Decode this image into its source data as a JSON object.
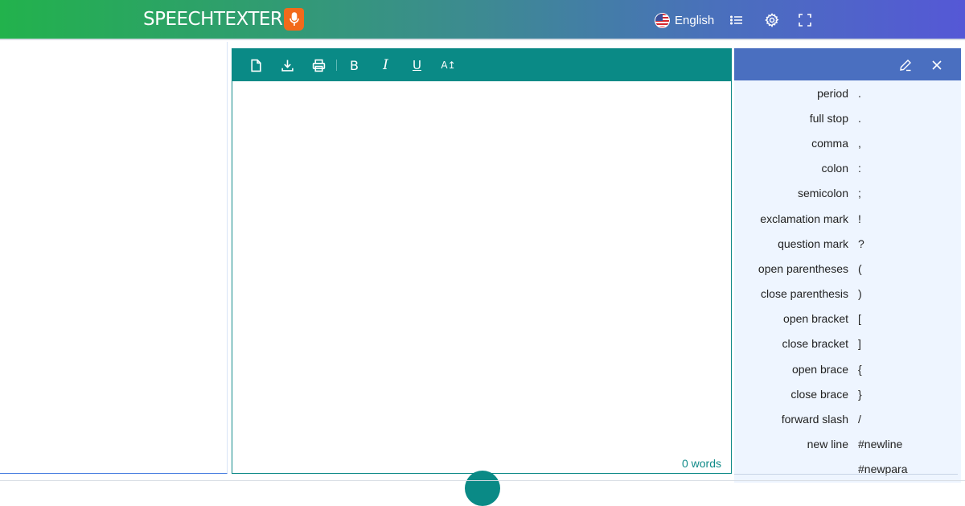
{
  "header": {
    "logo_text": "SPEECHTEXTER",
    "logo_icon": "microphone-icon",
    "language": {
      "label": "English",
      "flag_icon": "us-flag-icon"
    },
    "icons": [
      "list-icon",
      "gear-icon",
      "fullscreen-icon"
    ],
    "colors": {
      "gradient_start": "#22b24c",
      "gradient_end": "#5558d6",
      "logo_mic_bg": "#f26a1b"
    }
  },
  "editor": {
    "toolbar": {
      "new_icon": "new-document-icon",
      "download_icon": "download-icon",
      "print_icon": "print-icon",
      "bold_label": "B",
      "italic_label": "I",
      "underline_label": "U",
      "font_size_label": "A↥"
    },
    "text": "",
    "word_count": "0 words",
    "colors": {
      "toolbar_bg": "#0a8a86"
    }
  },
  "side_panel": {
    "edit_icon": "pencil-icon",
    "close_icon": "close-icon",
    "commands": [
      {
        "name": "period",
        "symbol": "."
      },
      {
        "name": "full stop",
        "symbol": "."
      },
      {
        "name": "comma",
        "symbol": ","
      },
      {
        "name": "colon",
        "symbol": ":"
      },
      {
        "name": "semicolon",
        "symbol": ";"
      },
      {
        "name": "exclamation mark",
        "symbol": "!"
      },
      {
        "name": "question mark",
        "symbol": "?"
      },
      {
        "name": "open parentheses",
        "symbol": "("
      },
      {
        "name": "close parenthesis",
        "symbol": ")"
      },
      {
        "name": "open bracket",
        "symbol": "["
      },
      {
        "name": "close bracket",
        "symbol": "]"
      },
      {
        "name": "open brace",
        "symbol": "{"
      },
      {
        "name": "close brace",
        "symbol": "}"
      },
      {
        "name": "forward slash",
        "symbol": "/"
      },
      {
        "name": "new line",
        "symbol": "#newline"
      },
      {
        "name": "",
        "symbol": "#newpara"
      }
    ],
    "colors": {
      "header_bg": "#4a6fc0",
      "body_bg": "#eef5ff"
    }
  }
}
